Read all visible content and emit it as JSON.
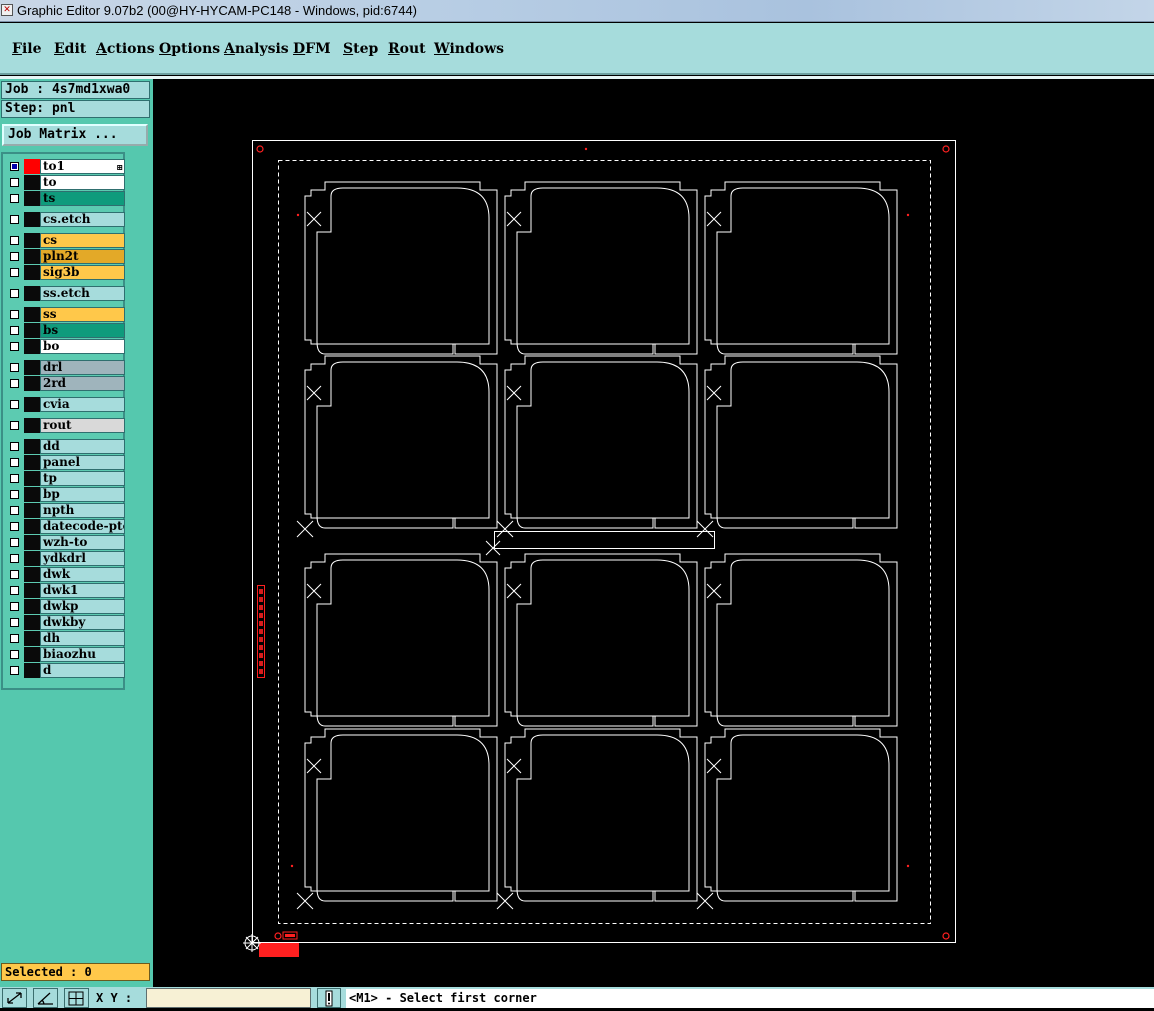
{
  "window": {
    "title": "Graphic Editor 9.07b2 (00@HY-HYCAM-PC148 - Windows, pid:6744)"
  },
  "menu": {
    "items": [
      "File",
      "Edit",
      "Actions",
      "Options",
      "Analysis",
      "DFM",
      "Step",
      "Rout",
      "Windows"
    ]
  },
  "info": {
    "job": "Job : 4s7md1xwa0",
    "step": "Step: pnl",
    "job_matrix_button": "Job Matrix ..."
  },
  "layers": [
    {
      "name": "to1",
      "color": "#ffffff",
      "checked": true,
      "swatch": "red"
    },
    {
      "name": "to",
      "color": "#ffffff"
    },
    {
      "name": "ts",
      "color": "#0f9b7c"
    },
    {
      "name": "cs.etch",
      "color": "#a6dcdc"
    },
    {
      "name": "cs",
      "color": "#ffc84a"
    },
    {
      "name": "pln2t",
      "color": "#e3a928"
    },
    {
      "name": "sig3b",
      "color": "#ffc84a"
    },
    {
      "name": "ss.etch",
      "color": "#a6dcdc"
    },
    {
      "name": "ss",
      "color": "#ffc84a"
    },
    {
      "name": "bs",
      "color": "#0f9b7c"
    },
    {
      "name": "bo",
      "color": "#ffffff"
    },
    {
      "name": "drl",
      "color": "#9fb4bc"
    },
    {
      "name": "2rd",
      "color": "#9fb4bc"
    },
    {
      "name": "cvia",
      "color": "#a6dcdc"
    },
    {
      "name": "rout",
      "color": "#d9d9d9"
    },
    {
      "name": "dd",
      "color": "#a6dcdc"
    },
    {
      "name": "panel",
      "color": "#a6dcdc"
    },
    {
      "name": "tp",
      "color": "#a6dcdc"
    },
    {
      "name": "bp",
      "color": "#a6dcdc"
    },
    {
      "name": "npth",
      "color": "#a6dcdc"
    },
    {
      "name": "datecode-pto",
      "color": "#a6dcdc"
    },
    {
      "name": "wzh-to",
      "color": "#a6dcdc"
    },
    {
      "name": "ydkdrl",
      "color": "#a6dcdc"
    },
    {
      "name": "dwk",
      "color": "#a6dcdc"
    },
    {
      "name": "dwk1",
      "color": "#a6dcdc"
    },
    {
      "name": "dwkp",
      "color": "#a6dcdc"
    },
    {
      "name": "dwkby",
      "color": "#a6dcdc"
    },
    {
      "name": "dh",
      "color": "#a6dcdc"
    },
    {
      "name": "biaozhu",
      "color": "#a6dcdc"
    },
    {
      "name": "d",
      "color": "#a6dcdc"
    }
  ],
  "status": {
    "selected": "Selected : 0",
    "xy_label": "X Y :",
    "xy_value": "",
    "message": "<M1> - Select first corner"
  },
  "colors": {
    "panel_bg": "#55c8ae",
    "menu_bg": "#a6dcdc",
    "outline": "#ffffff",
    "fiducial": "#ff2020"
  }
}
